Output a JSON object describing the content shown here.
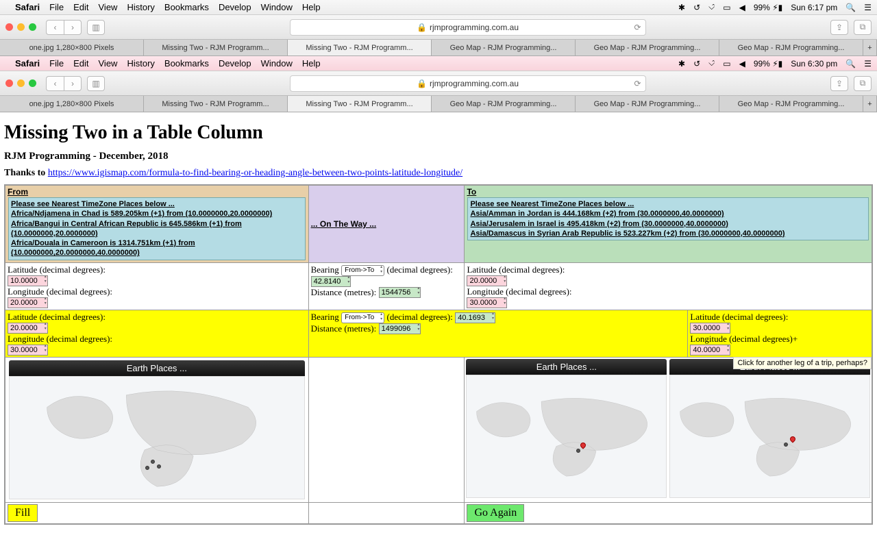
{
  "menubar1": {
    "app": "Safari",
    "items": [
      "File",
      "Edit",
      "View",
      "History",
      "Bookmarks",
      "Develop",
      "Window",
      "Help"
    ],
    "battery": "99%",
    "clock": "Sun 6:17 pm"
  },
  "menubar2": {
    "app": "Safari",
    "items": [
      "File",
      "Edit",
      "View",
      "History",
      "Bookmarks",
      "Develop",
      "Window",
      "Help"
    ],
    "battery": "99%",
    "clock": "Sun 6:30 pm"
  },
  "url": "rjmprogramming.com.au",
  "tabs": [
    "one.jpg 1,280×800 Pixels",
    "Missing Two - RJM Programm...",
    "Missing Two - RJM Programm...",
    "Geo Map - RJM Programming...",
    "Geo Map - RJM Programming...",
    "Geo Map - RJM Programming..."
  ],
  "page": {
    "title": "Missing Two in a Table Column",
    "subtitle": "RJM Programming - December, 2018",
    "thanks_prefix": "Thanks to ",
    "thanks_link": "https://www.igismap.com/formula-to-find-bearing-or-heading-angle-between-two-points-latitude-longitude/"
  },
  "headers": {
    "from": "From",
    "mid": "... On The Way ...",
    "to": "To"
  },
  "tz_from": {
    "intro": "Please see Nearest TimeZone Places below ...",
    "lines": [
      "Africa/Ndjamena in Chad is 589.205km (+1) from (10.0000000,20.0000000)",
      "Africa/Bangui in Central African Republic is 645.586km (+1) from (10.0000000,20.0000000)",
      "Africa/Douala in Cameroon is 1314.751km (+1) from (10.0000000,20.0000000,40.0000000)"
    ]
  },
  "tz_to": {
    "intro": "Please see Nearest TimeZone Places below ...",
    "lines": [
      "Asia/Amman in Jordan is 444.168km (+2) from (30.0000000,40.0000000)",
      "Asia/Jerusalem in Israel is 495.418km (+2) from (30.0000000,40.0000000)",
      "Asia/Damascus in Syrian Arab Republic is 523.227km (+2) from (30.0000000,40.0000000)"
    ]
  },
  "labels": {
    "lat": "Latitude (decimal degrees):",
    "lon": "Longitude (decimal degrees):",
    "lon_plus": "Longitude (decimal degrees)+",
    "bearing": "Bearing",
    "bearing_suffix": "(decimal degrees):",
    "distance": "Distance (metres):",
    "direction": "From->To"
  },
  "row1": {
    "from_lat": "10.0000",
    "from_lon": "20.0000",
    "bearing": "42.8140",
    "distance": "1544756",
    "to_lat": "20.0000",
    "to_lon": "30.0000"
  },
  "row2": {
    "from_lat": "20.0000",
    "from_lon": "30.0000",
    "bearing": "40.1693",
    "distance": "1499096",
    "to_lat": "30.0000",
    "to_lon": "40.0000"
  },
  "tooltip": "Click for another leg of a trip, perhaps?",
  "maps": {
    "title": "Earth Places ..."
  },
  "buttons": {
    "fill": "Fill",
    "go": "Go Again"
  }
}
